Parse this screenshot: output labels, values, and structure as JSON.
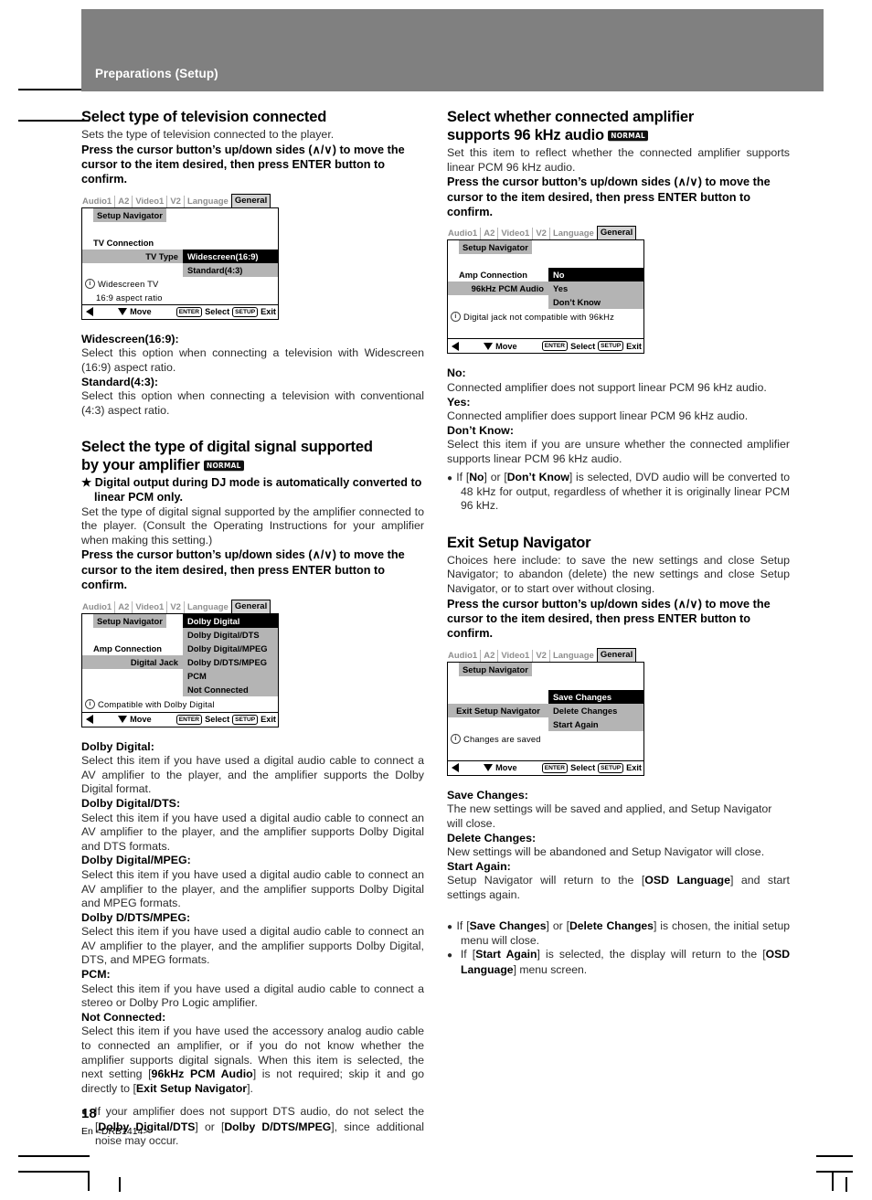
{
  "header": {
    "title": "Preparations (Setup)"
  },
  "footer": {
    "page_number": "18",
    "code": "En <DRB1414>"
  },
  "badge": {
    "label": "NORMAL"
  },
  "osd_common": {
    "tabs": [
      "Audio1",
      "A2",
      "Video1",
      "V2",
      "Language",
      "General"
    ],
    "active_tab": "General",
    "nav_label": "Setup Navigator",
    "foot_move": "Move",
    "foot_enter_key": "ENTER",
    "foot_select": "Select",
    "foot_setup_key": "SETUP",
    "foot_exit": "Exit"
  },
  "left": {
    "section1": {
      "heading": "Select type of television connected",
      "intro": "Sets the type of television connected to the player.",
      "lead": "Press the cursor button’s up/down sides (∧/∨) to move the cursor to the item desired, then press ENTER button to confirm.",
      "osd": {
        "row1_label": "TV Connection",
        "row2_label": "TV Type",
        "options": [
          "Widescreen(16:9)",
          "Standard(4:3)"
        ],
        "selected": "Widescreen(16:9)",
        "info_line1": "Widescreen TV",
        "info_line2": "16:9 aspect ratio"
      },
      "terms": [
        {
          "name": "Widescreen(16:9):",
          "desc": "Select this option when connecting a television with Widescreen (16:9) aspect ratio."
        },
        {
          "name": "Standard(4:3):",
          "desc": "Select this option when connecting a television with conventional (4:3) aspect ratio."
        }
      ]
    },
    "section2": {
      "heading_line1": "Select the type of digital signal supported",
      "heading_line2": "by your amplifier",
      "star_note": "★ Digital output during DJ mode is automatically converted to linear PCM only.",
      "intro": "Set the type of digital signal supported by the amplifier connected to the player. (Consult the Operating Instructions for your amplifier when making this setting.)",
      "lead": "Press the cursor button’s up/down sides (∧/∨) to move the cursor to the item desired, then press ENTER button to confirm.",
      "osd": {
        "row1_label": "Amp Connection",
        "row2_label": "Digital Jack",
        "options": [
          "Dolby Digital",
          "Dolby Digital/DTS",
          "Dolby Digital/MPEG",
          "Dolby D/DTS/MPEG",
          "PCM",
          "Not Connected"
        ],
        "selected": "Dolby Digital",
        "info_line1": "Compatible with Dolby Digital"
      },
      "terms": [
        {
          "name": "Dolby Digital:",
          "desc": "Select this item if you have used a digital audio cable to connect a AV amplifier to the player, and the amplifier supports the Dolby Digital format."
        },
        {
          "name": "Dolby Digital/DTS:",
          "desc": "Select this item if you have used a digital audio cable to connect an AV amplifier to the player, and the amplifier supports Dolby Digital and DTS formats."
        },
        {
          "name": "Dolby Digital/MPEG:",
          "desc": "Select this item if you have used a digital audio cable to connect an AV amplifier to the player, and the amplifier supports Dolby Digital and MPEG formats."
        },
        {
          "name": "Dolby D/DTS/MPEG:",
          "desc": "Select this item if you have used a digital audio cable to connect an AV amplifier to the player, and the amplifier supports Dolby Digital, DTS, and MPEG formats."
        },
        {
          "name": "PCM:",
          "desc": "Select this item if you have used a digital audio cable to connect a stereo or Dolby Pro Logic amplifier."
        },
        {
          "name": "Not Connected:",
          "desc": "Select this item if you have used the accessory analog audio cable to connected an amplifier, or if you do not know whether the amplifier supports digital signals. When this item is selected, the next setting [96kHz PCM Audio] is not required; skip it and go directly to [Exit Setup Navigator]."
        }
      ],
      "bullet": "If your amplifier does not support DTS audio, do not select the [Dolby Digital/DTS] or [Dolby D/DTS/MPEG], since additional noise may occur."
    }
  },
  "right": {
    "section1": {
      "heading_line1": "Select whether connected amplifier",
      "heading_line2": "supports 96 kHz audio",
      "intro": "Set this item to reflect whether the connected amplifier supports linear PCM 96 kHz audio.",
      "lead": "Press the cursor button’s up/down sides (∧/∨) to move the cursor to the item desired, then press ENTER button to confirm.",
      "osd": {
        "row1_label": "Amp Connection",
        "row2_label": "96kHz PCM Audio",
        "options": [
          "No",
          "Yes",
          "Don’t Know"
        ],
        "selected": "No",
        "info_line1": "Digital jack not compatible with 96kHz"
      },
      "terms": [
        {
          "name": "No:",
          "desc": "Connected amplifier does not support linear PCM 96 kHz audio."
        },
        {
          "name": "Yes:",
          "desc": "Connected amplifier does support linear PCM 96 kHz audio."
        },
        {
          "name": "Don’t Know:",
          "desc": "Select this item if you are unsure whether the connected amplifier supports linear PCM 96 kHz audio."
        }
      ],
      "bullet": "If [No] or [Don’t Know] is selected, DVD audio will be converted to 48 kHz for output, regardless of whether it is originally linear PCM 96 kHz."
    },
    "section2": {
      "heading": "Exit Setup Navigator",
      "intro": "Choices here include: to save the new settings and close Setup Navigator; to abandon (delete) the new settings and close Setup Navigator, or to start over without closing.",
      "lead": "Press the cursor button’s up/down sides (∧/∨) to move the cursor to the item desired, then press ENTER button to confirm.",
      "osd": {
        "row2_label": "Exit Setup Navigator",
        "options": [
          "Save Changes",
          "Delete Changes",
          "Start Again"
        ],
        "selected": "Save Changes",
        "info_line1": "Changes are saved"
      },
      "terms": [
        {
          "name": "Save Changes:",
          "desc": "The new settings will be saved and applied, and Setup Navigator will close."
        },
        {
          "name": "Delete Changes:",
          "desc": "New settings will be abandoned and Setup Navigator will close."
        },
        {
          "name": "Start Again:",
          "desc": "Setup Navigator will return to the [OSD Language] and start settings again."
        }
      ],
      "bullet1": "If [Save Changes] or [Delete Changes] is chosen, the initial setup menu will close.",
      "bullet2": "If [Start Again] is selected, the display will return to the [OSD Language] menu screen."
    }
  }
}
